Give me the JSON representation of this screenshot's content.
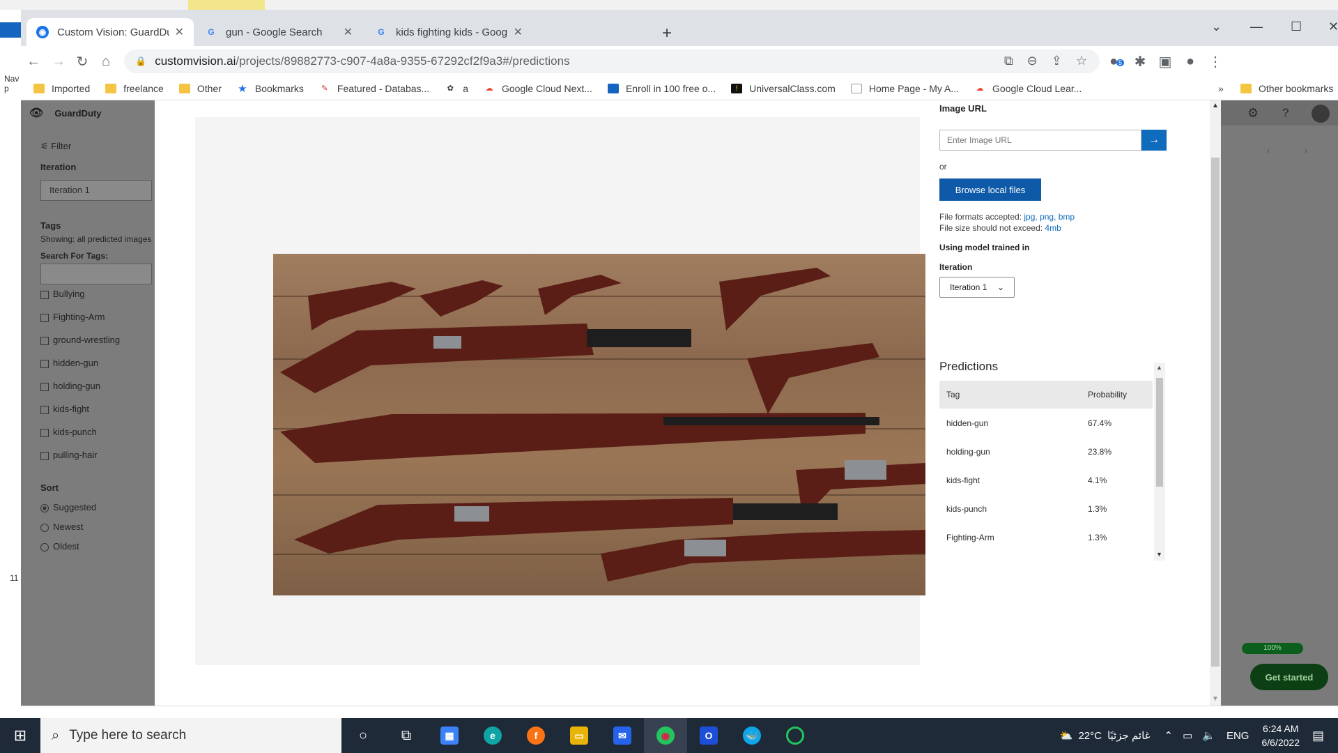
{
  "browser": {
    "tabs": [
      {
        "title": "Custom Vision: GuardDuty - Predictions",
        "favicon": "custom-vision-icon"
      },
      {
        "title": "gun - Google Search",
        "favicon": "google-icon"
      },
      {
        "title": "kids fighting kids - Google Search",
        "favicon": "google-icon"
      }
    ],
    "url_host": "customvision.ai",
    "url_path": "/projects/89882773-c907-4a8a-9355-67292cf2f9a3#/predictions",
    "bookmarks": [
      {
        "label": "Imported",
        "icon": "folder-icon"
      },
      {
        "label": "freelance",
        "icon": "folder-icon"
      },
      {
        "label": "Other",
        "icon": "folder-icon"
      },
      {
        "label": "Bookmarks",
        "icon": "star-icon"
      },
      {
        "label": "Featured - Databas...",
        "icon": "site-icon"
      },
      {
        "label": "a",
        "icon": "site-icon"
      },
      {
        "label": "Google Cloud Next...",
        "icon": "google-cloud-icon"
      },
      {
        "label": "Enroll in 100 free o...",
        "icon": "site-icon"
      },
      {
        "label": "UniversalClass.com",
        "icon": "site-icon"
      },
      {
        "label": "Home Page - My A...",
        "icon": "site-icon"
      },
      {
        "label": "Google Cloud Lear...",
        "icon": "google-cloud-icon"
      }
    ],
    "other_bookmarks": "Other bookmarks",
    "ext_badge": "5"
  },
  "background_app": {
    "nav_text": "Nav",
    "nav_text2": "p",
    "side_number": "11"
  },
  "left_panel": {
    "project": "GuardDuty",
    "filter": "Filter",
    "iteration_heading": "Iteration",
    "iteration_value": "Iteration 1",
    "tags_heading": "Tags",
    "showing": "Showing: all predicted images",
    "search_tags": "Search For Tags:",
    "tags": [
      "Bullying",
      "Fighting-Arm",
      "ground-wrestling",
      "hidden-gun",
      "holding-gun",
      "kids-fight",
      "kids-punch",
      "pulling-hair"
    ],
    "sort_heading": "Sort",
    "sort_options": [
      "Suggested",
      "Newest",
      "Oldest"
    ]
  },
  "right_panel": {
    "progress": "100%",
    "get_started": "Get started"
  },
  "modal": {
    "image_url_label": "Image URL",
    "image_url_placeholder": "Enter Image URL",
    "or": "or",
    "browse": "Browse local files",
    "formats_prefix": "File formats accepted: ",
    "formats": "jpg, png, bmp",
    "size_prefix": "File size should not exceed: ",
    "size": "4mb",
    "using_model": "Using model trained in",
    "iteration_label": "Iteration",
    "iteration_value": "Iteration 1",
    "predictions_title": "Predictions",
    "table_header": {
      "tag": "Tag",
      "probability": "Probability"
    },
    "predictions": [
      {
        "tag": "hidden-gun",
        "probability": "67.4%"
      },
      {
        "tag": "holding-gun",
        "probability": "23.8%"
      },
      {
        "tag": "kids-fight",
        "probability": "4.1%"
      },
      {
        "tag": "kids-punch",
        "probability": "1.3%"
      },
      {
        "tag": "Fighting-Arm",
        "probability": "1.3%"
      }
    ]
  },
  "taskbar": {
    "search_placeholder": "Type here to search",
    "temperature": "22°C",
    "weather": "غائم جزئيًا",
    "lang": "ENG",
    "time": "6:24 AM",
    "date": "6/6/2022"
  },
  "colors": {
    "accent": "#0f6cbd",
    "browse_button": "#0f5aa8",
    "taskbar": "#1f2a38"
  }
}
